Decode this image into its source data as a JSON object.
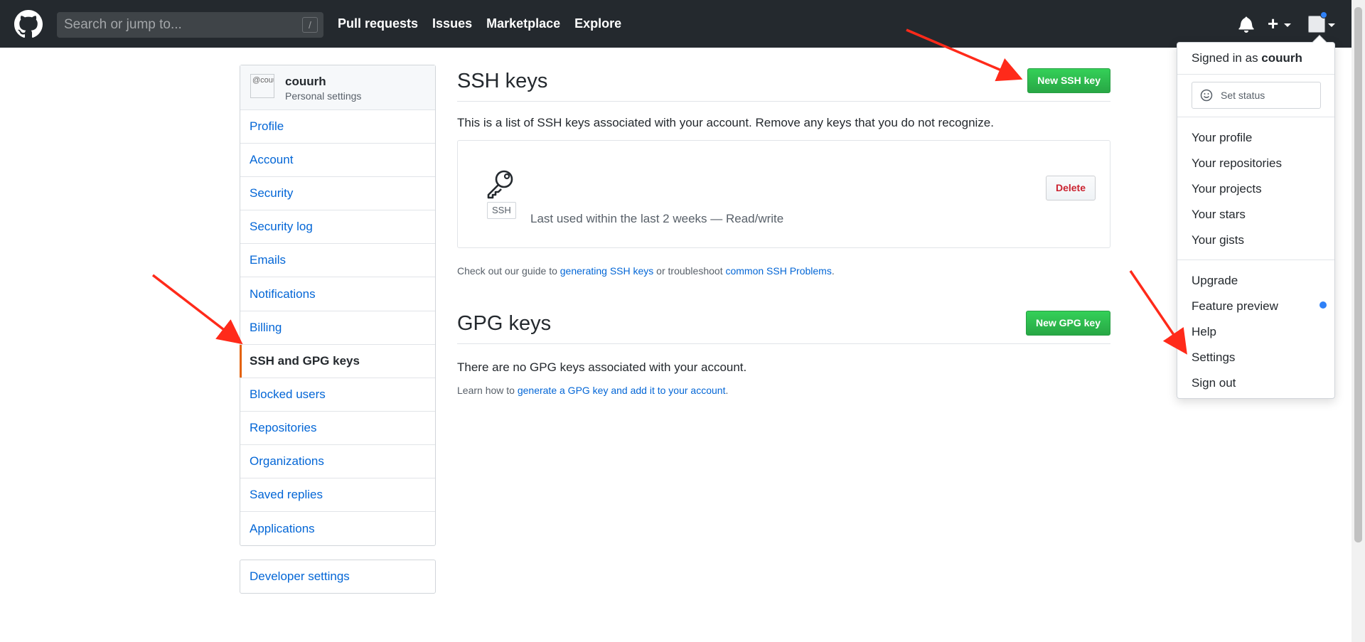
{
  "header": {
    "search_placeholder": "Search or jump to...",
    "search_shortcut": "/",
    "nav": [
      "Pull requests",
      "Issues",
      "Marketplace",
      "Explore"
    ],
    "plus_label": "+",
    "icons": {
      "logo": "github-octocat-icon",
      "bell": "bell-icon",
      "avatar": "avatar-icon"
    },
    "notification_dot_color": "#2f81f7"
  },
  "sidebar": {
    "username": "couurh",
    "subtitle": "Personal settings",
    "avatar_alt": "@couurh",
    "items": [
      {
        "label": "Profile"
      },
      {
        "label": "Account"
      },
      {
        "label": "Security"
      },
      {
        "label": "Security log"
      },
      {
        "label": "Emails"
      },
      {
        "label": "Notifications"
      },
      {
        "label": "Billing"
      },
      {
        "label": "SSH and GPG keys",
        "active": true
      },
      {
        "label": "Blocked users"
      },
      {
        "label": "Repositories"
      },
      {
        "label": "Organizations"
      },
      {
        "label": "Saved replies"
      },
      {
        "label": "Applications"
      }
    ],
    "developer_settings": "Developer settings",
    "active_color": "#e36209"
  },
  "ssh": {
    "title": "SSH keys",
    "new_button": "New SSH key",
    "intro": "This is a list of SSH keys associated with your account. Remove any keys that you do not recognize.",
    "key": {
      "badge": "SSH",
      "meta": "Last used within the last 2 weeks — Read/write",
      "delete_label": "Delete"
    },
    "guide": {
      "prefix": "Check out our guide to ",
      "link1": "generating SSH keys",
      "middle": " or troubleshoot ",
      "link2": "common SSH Problems",
      "suffix": "."
    }
  },
  "gpg": {
    "title": "GPG keys",
    "new_button": "New GPG key",
    "empty": "There are no GPG keys associated with your account.",
    "learn_prefix": "Learn how to ",
    "learn_link": "generate a GPG key and add it to your account",
    "learn_suffix": "."
  },
  "dropdown": {
    "signed_in_prefix": "Signed in as ",
    "username": "couurh",
    "set_status": "Set status",
    "group1": [
      "Your profile",
      "Your repositories",
      "Your projects",
      "Your stars",
      "Your gists"
    ],
    "group2": [
      "Upgrade",
      "Feature preview",
      "Help",
      "Settings",
      "Sign out"
    ]
  },
  "colors": {
    "header_bg": "#24292e",
    "link": "#0366d6",
    "green_button": "#28a745",
    "danger": "#cb2431",
    "annotation_arrow": "#ff2a1a"
  }
}
